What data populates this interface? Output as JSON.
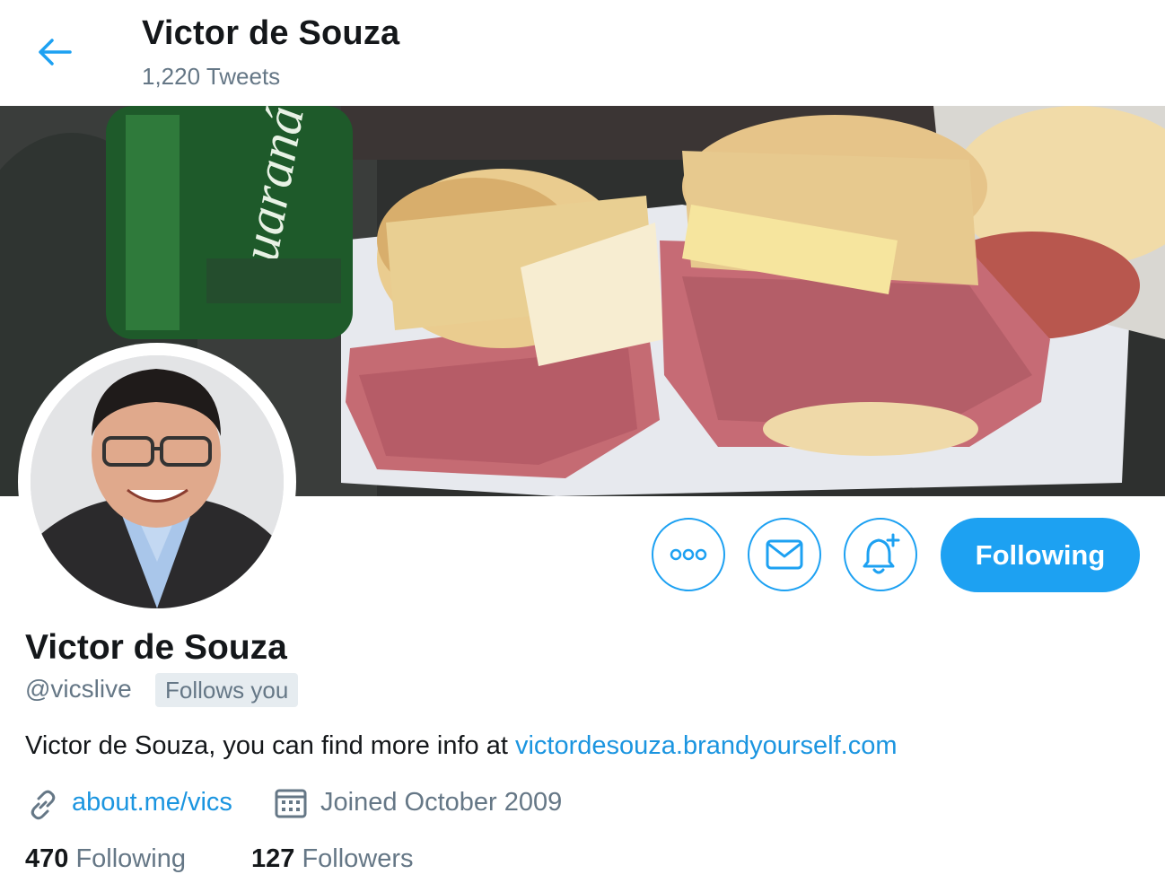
{
  "header": {
    "title": "Victor de Souza",
    "tweet_count": "1,220 Tweets"
  },
  "banner": {
    "description": "Banner photo of two halves of a mortadella sandwich next to a Guaraná Antarctica can",
    "can_text": "Guaraná ANTARCTICA"
  },
  "actions": {
    "more_icon": "more-icon",
    "message_icon": "envelope-icon",
    "notify_icon": "bell-plus-icon",
    "following_label": "Following"
  },
  "profile": {
    "name": "Victor de Souza",
    "handle": "@vicslive",
    "follows_you": "Follows you",
    "bio_text": "Victor de Souza, you can find more info at ",
    "bio_link": "victordesouza.brandyourself.com",
    "website": "about.me/vics",
    "joined": "Joined October 2009"
  },
  "stats": {
    "following_count": "470",
    "following_label": "Following",
    "followers_count": "127",
    "followers_label": "Followers"
  },
  "colors": {
    "accent": "#1da1f2",
    "link": "#1b95e0",
    "secondary_text": "#657786",
    "badge_bg": "#e6ecf0"
  }
}
